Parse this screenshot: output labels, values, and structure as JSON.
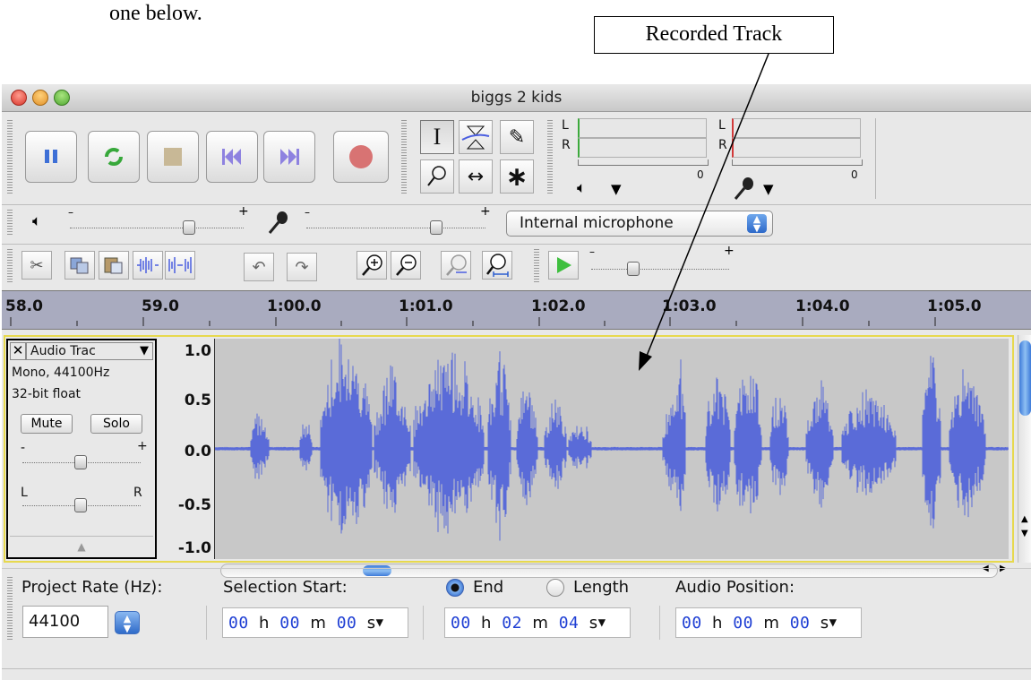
{
  "document": {
    "text_fragment": "one below.",
    "callout_label": "Recorded Track"
  },
  "window": {
    "title": "biggs 2 kids"
  },
  "meters": {
    "left": "L",
    "right": "R",
    "zero": "0"
  },
  "mixer": {
    "input_device": "Internal microphone"
  },
  "ruler": {
    "labels": [
      "58.0",
      "59.0",
      "1:00.0",
      "1:01.0",
      "1:02.0",
      "1:03.0",
      "1:04.0",
      "1:05.0"
    ]
  },
  "track": {
    "name": "Audio Trac",
    "format": "Mono, 44100Hz",
    "bit_depth": "32-bit float",
    "mute_label": "Mute",
    "solo_label": "Solo",
    "pan_left": "L",
    "pan_right": "R",
    "y_ticks": [
      "1.0",
      "0.5",
      "0.0",
      "-0.5",
      "-1.0"
    ],
    "gain_minus": "-",
    "gain_plus": "+"
  },
  "selection_bar": {
    "project_rate_label": "Project Rate (Hz):",
    "project_rate_value": "44100",
    "selection_start_label": "Selection Start:",
    "end_label": "End",
    "length_label": "Length",
    "audio_position_label": "Audio Position:",
    "start_time": {
      "h": "00",
      "m": "00",
      "s": "00"
    },
    "end_time": {
      "h": "00",
      "m": "02",
      "s": "04"
    },
    "audio_position": {
      "h": "00",
      "m": "00",
      "s": "00"
    },
    "unit_h": "h",
    "unit_m": "m",
    "unit_s": "s"
  },
  "colors": {
    "waveform": "#5a6bd8",
    "track_bg": "#c8c8c8",
    "ruler_bg": "#a9abbf",
    "record": "#d87373",
    "play": "#3fbf3f",
    "time_digits": "#1f3fd4"
  }
}
